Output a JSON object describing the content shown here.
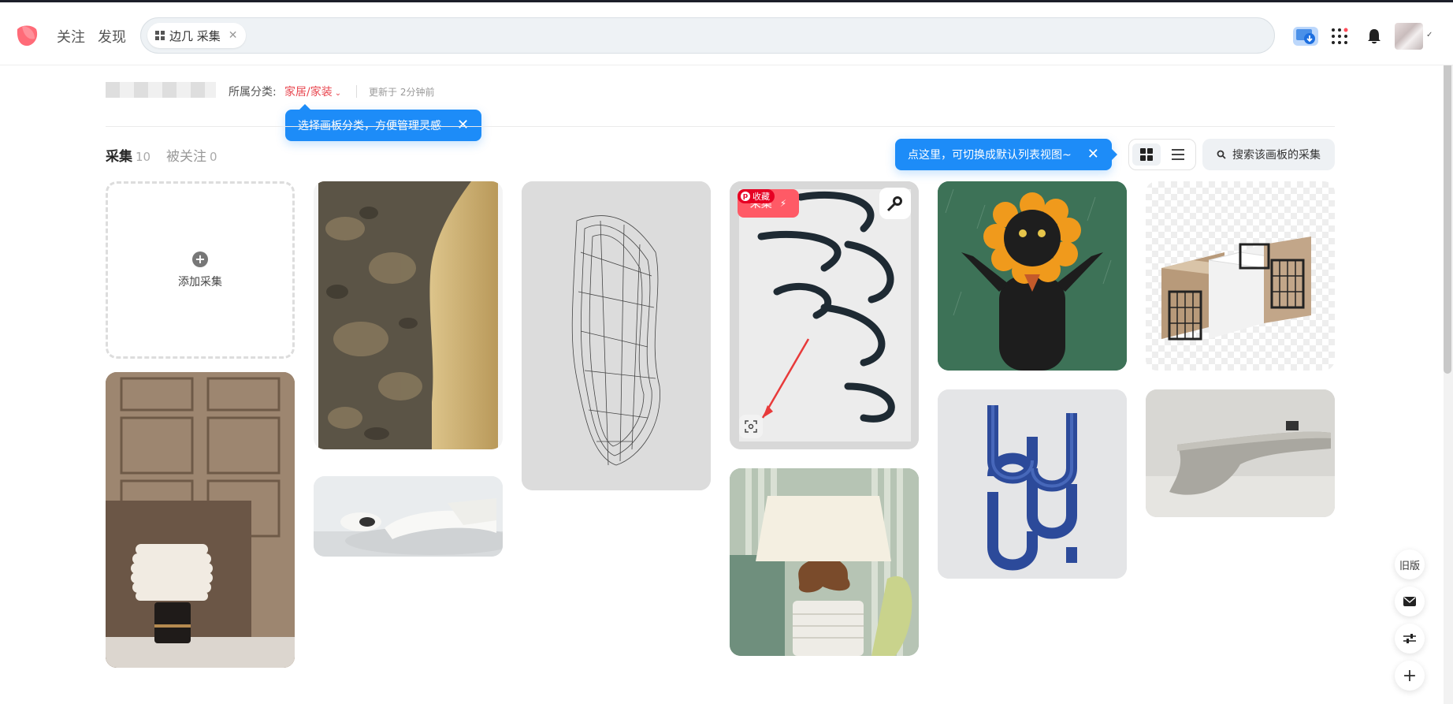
{
  "header": {
    "nav": [
      "关注",
      "发现"
    ],
    "search_chip": "边几 采集",
    "search_chip_close": "✕",
    "icons": [
      "cloud-upload-icon",
      "grid-apps-icon",
      "bell-icon",
      "avatar"
    ],
    "accent": "#ff4d5a"
  },
  "board": {
    "category_label": "所属分类:",
    "category_value": "家居/家装",
    "updated": "更新于 2分钟前"
  },
  "tips": {
    "category_tip": "选择画板分类，方便管理灵感",
    "view_tip": "点这里，可切换成默认列表视图~",
    "close": "✕"
  },
  "tabs": [
    {
      "label": "采集",
      "count": "10"
    },
    {
      "label": "被关注",
      "count": "0"
    }
  ],
  "toolbar": {
    "search_board": "搜索该画板的采集"
  },
  "add_pin": {
    "label": "添加采集"
  },
  "pin_overlay": {
    "save_badge": "收藏",
    "collect_button": "采集"
  },
  "side_actions": {
    "old_version": "旧版"
  },
  "pins": [
    "marble-gold-panel",
    "circular-wire-sculpture",
    "black-brush-strokes",
    "sunflower-cat",
    "modular-bench",
    "wood-panel-lamp",
    "white-curved-sofa",
    "ceramic-table-lamp",
    "blue-chain-sculpture",
    "curved-reception-desk"
  ]
}
